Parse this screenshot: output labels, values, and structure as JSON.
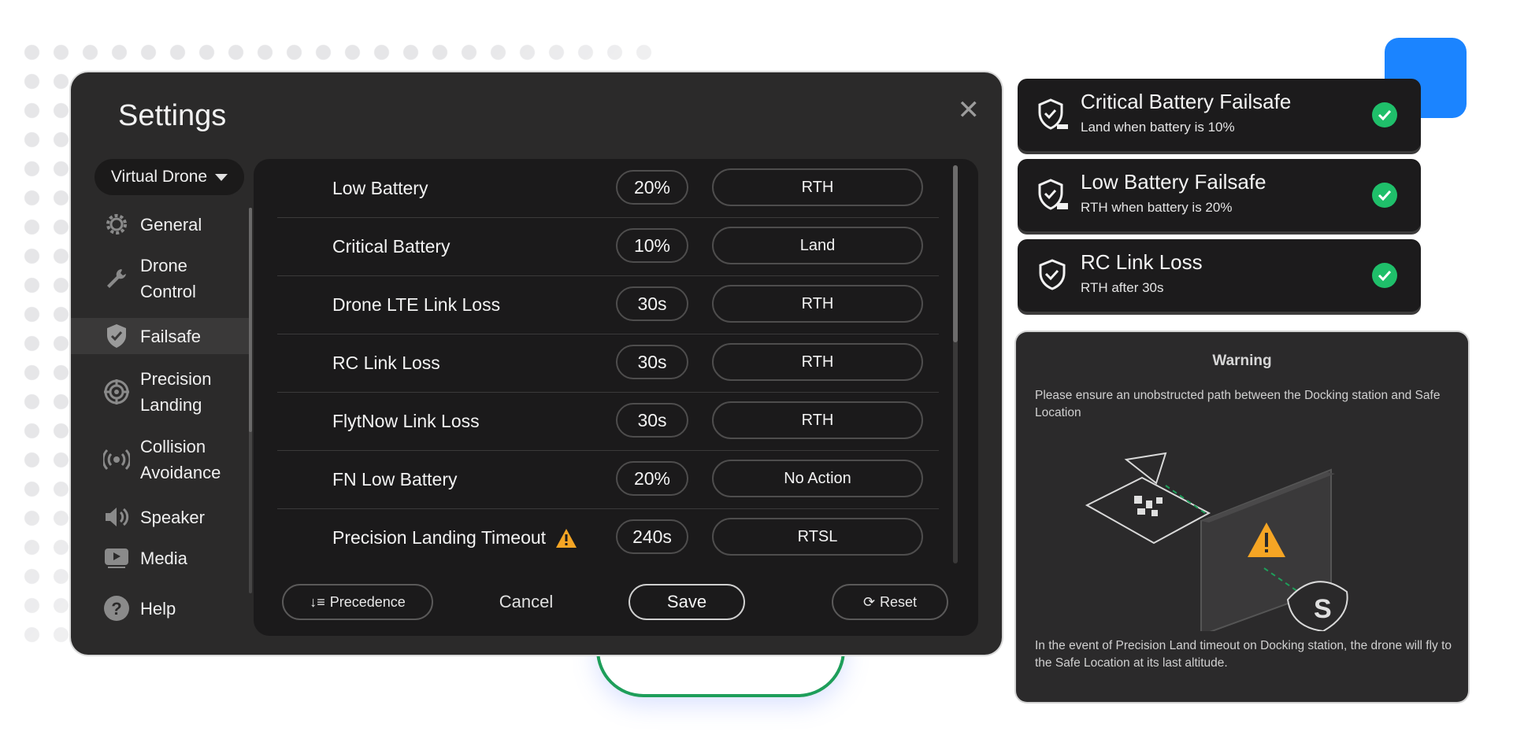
{
  "settings": {
    "title": "Settings",
    "drone_selector": "Virtual Drone",
    "nav": [
      {
        "label": "General",
        "icon": "gear-icon"
      },
      {
        "label": "Drone\nControl",
        "icon": "wrench-icon"
      },
      {
        "label": "Failsafe",
        "icon": "shield-check-icon",
        "active": true
      },
      {
        "label": "Precision\nLanding",
        "icon": "target-icon"
      },
      {
        "label": "Collision\nAvoidance",
        "icon": "radar-icon"
      },
      {
        "label": "Speaker",
        "icon": "speaker-icon"
      },
      {
        "label": "Media",
        "icon": "media-play-icon"
      },
      {
        "label": "Help",
        "icon": "help-icon"
      }
    ],
    "rows": [
      {
        "label": "Low Battery",
        "value": "20%",
        "action": "RTH"
      },
      {
        "label": "Critical Battery",
        "value": "10%",
        "action": "Land"
      },
      {
        "label": "Drone LTE Link Loss",
        "value": "30s",
        "action": "RTH"
      },
      {
        "label": "RC Link Loss",
        "value": "30s",
        "action": "RTH"
      },
      {
        "label": "FlytNow Link Loss",
        "value": "30s",
        "action": "RTH"
      },
      {
        "label": "FN Low Battery",
        "value": "20%",
        "action": "No Action"
      },
      {
        "label": "Precision Landing Timeout",
        "value": "240s",
        "action": "RTSL",
        "warning": true
      }
    ],
    "buttons": {
      "precedence": "Precedence",
      "cancel": "Cancel",
      "save": "Save",
      "reset": "Reset"
    }
  },
  "toasts": [
    {
      "title": "Critical Battery Failsafe",
      "subtitle": "Land when battery is 10%"
    },
    {
      "title": "Low Battery Failsafe",
      "subtitle": "RTH when battery is 20%"
    },
    {
      "title": "RC Link Loss",
      "subtitle": "RTH after 30s"
    }
  ],
  "warning": {
    "title": "Warning",
    "text_top": "Please ensure an unobstructed path between the Docking station and Safe Location",
    "text_bottom": "In the event of Precision Land timeout on Docking station, the drone will fly to the Safe Location at its last  altitude."
  },
  "colors": {
    "accent_blue": "#1b84ff",
    "success_green": "#1fbf6a",
    "warning_orange": "#f5a524"
  }
}
